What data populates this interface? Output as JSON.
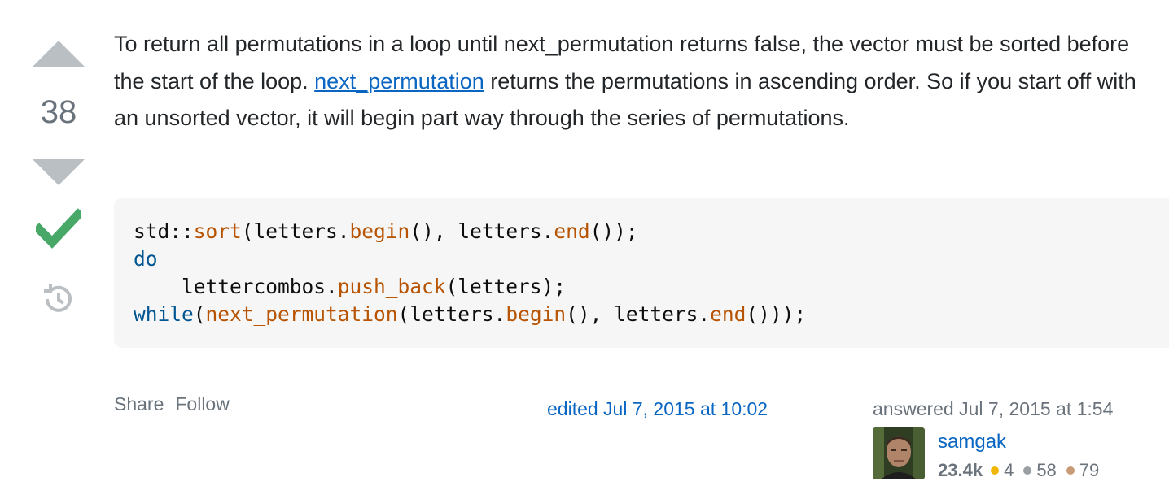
{
  "vote": {
    "score": "38",
    "up_icon": "arrow-up-icon",
    "down_icon": "arrow-down-icon",
    "accepted_icon": "checkmark-icon",
    "history_icon": "history-icon"
  },
  "answer": {
    "paragraph_part1": "To return all permutations in a loop until next_permutation returns false, the vector must be sorted before the start of the loop. ",
    "link_text": "next_permutation",
    "paragraph_part2": " returns the permutations in ascending order. So if you start off with an unsorted vector, it will begin part way through the series of permutations."
  },
  "code": {
    "line1": [
      "std::",
      "sort",
      "(letters.",
      "begin",
      "(), letters.",
      "end",
      "());"
    ],
    "line2": [
      "do"
    ],
    "line3": [
      "    lettercombos.",
      "push_back",
      "(letters);"
    ],
    "line4": [
      "while",
      "(",
      "next_permutation",
      "(letters.",
      "begin",
      "(), letters.",
      "end",
      "()));"
    ]
  },
  "menu": {
    "share_label": "Share",
    "follow_label": "Follow"
  },
  "edited": {
    "label": "edited Jul 7, 2015 at 10:02"
  },
  "user": {
    "answered_label": "answered Jul 7, 2015 at 1:54",
    "name": "samgak",
    "reputation": "23.4k",
    "gold": "4",
    "silver": "58",
    "bronze": "79",
    "colors": {
      "gold": "#f1b600",
      "silver": "#9a9fa5",
      "bronze": "#c89b75"
    }
  },
  "colors": {
    "link": "#0a66c2",
    "vote_arrow": "#babfc4",
    "accepted": "#48a868",
    "code_bg": "#f6f6f6",
    "code_fn": "#b75301",
    "code_kw": "#015692"
  }
}
